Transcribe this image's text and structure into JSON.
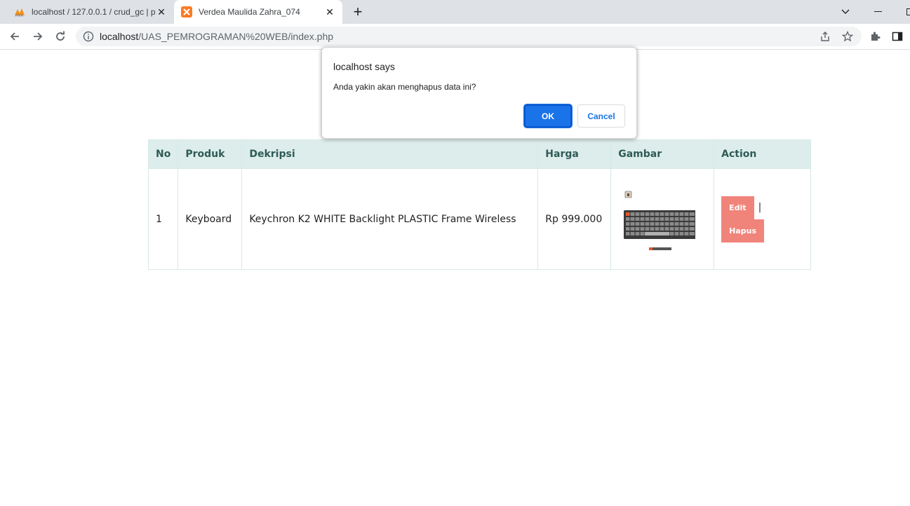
{
  "browser": {
    "tabs": [
      {
        "title": "localhost / 127.0.0.1 / crud_gc | p",
        "active": false
      },
      {
        "title": "Verdea Maulida Zahra_074",
        "active": true
      }
    ],
    "new_tab_label": "+",
    "url_host": "localhost",
    "url_path": "/UAS_PEMROGRAMAN%20WEB/index.php"
  },
  "table": {
    "headers": [
      "No",
      "Produk",
      "Dekripsi",
      "Harga",
      "Gambar",
      "Action"
    ],
    "rows": [
      {
        "no": "1",
        "produk": "Keyboard",
        "deskripsi": "Keychron K2 WHITE Backlight PLASTIC Frame Wireless",
        "harga": "Rp 999.000",
        "gambar": "keyboard-image",
        "edit_label": "Edit",
        "separator": "|",
        "hapus_label": "Hapus"
      }
    ]
  },
  "dialog": {
    "title": "localhost says",
    "message": "Anda yakin akan menghapus data ini?",
    "ok_label": "OK",
    "cancel_label": "Cancel"
  },
  "colors": {
    "header_bg": "#dcedec",
    "header_text": "#2f5b55",
    "action_button": "#f1847a",
    "dialog_ok": "#1a73e8"
  }
}
